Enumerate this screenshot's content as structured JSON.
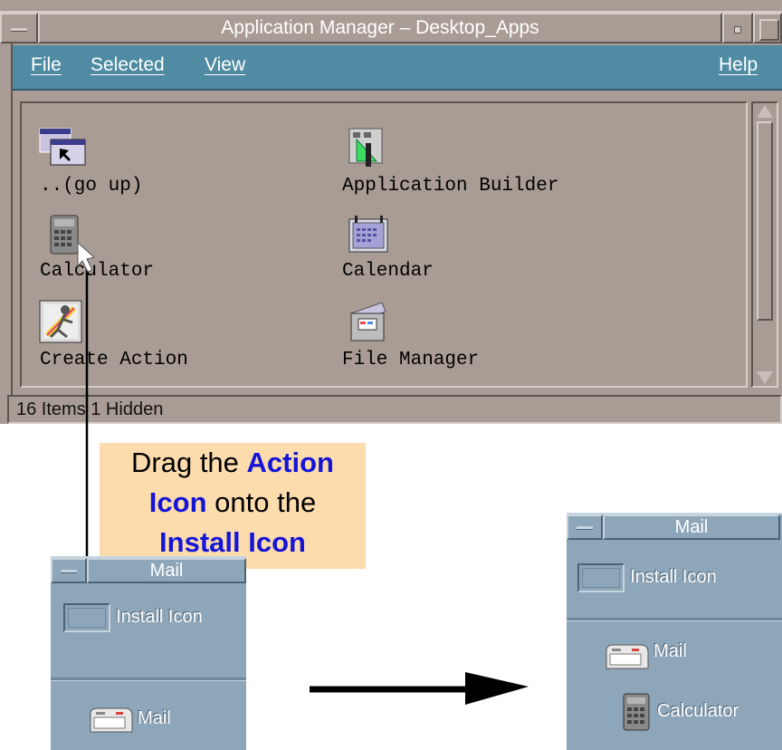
{
  "app_window": {
    "title": "Application Manager – Desktop_Apps",
    "menu": {
      "file": "File",
      "selected": "Selected",
      "view": "View",
      "help": "Help"
    },
    "icons": [
      {
        "label": "..(go up)",
        "icon": "folder-up-icon"
      },
      {
        "label": "Application Builder",
        "icon": "application-builder-icon"
      },
      {
        "label": "Calculator",
        "icon": "calculator-icon"
      },
      {
        "label": "Calendar",
        "icon": "calendar-icon"
      },
      {
        "label": "Create Action",
        "icon": "create-action-icon"
      },
      {
        "label": "File Manager",
        "icon": "file-manager-icon"
      }
    ],
    "status": "16 Items 1 Hidden"
  },
  "callout": {
    "line1_plain": "Drag the",
    "line1_bold": "Action",
    "line2_bold": "Icon",
    "line2_plain": "onto the",
    "line3_bold": "Install Icon"
  },
  "panel_before": {
    "title": "Mail",
    "install_label": "Install Icon",
    "items": [
      {
        "label": "Mail",
        "icon": "mail-icon"
      }
    ]
  },
  "panel_after": {
    "title": "Mail",
    "install_label": "Install Icon",
    "items": [
      {
        "label": "Mail",
        "icon": "mail-icon"
      },
      {
        "label": "Calculator",
        "icon": "calculator-icon"
      }
    ]
  },
  "colors": {
    "window_bg": "#a99c94",
    "menubar": "#4f8ba3",
    "panel_bg": "#8ea6b9",
    "callout_bg": "#fcdcad",
    "callout_highlight": "#1515d8"
  }
}
